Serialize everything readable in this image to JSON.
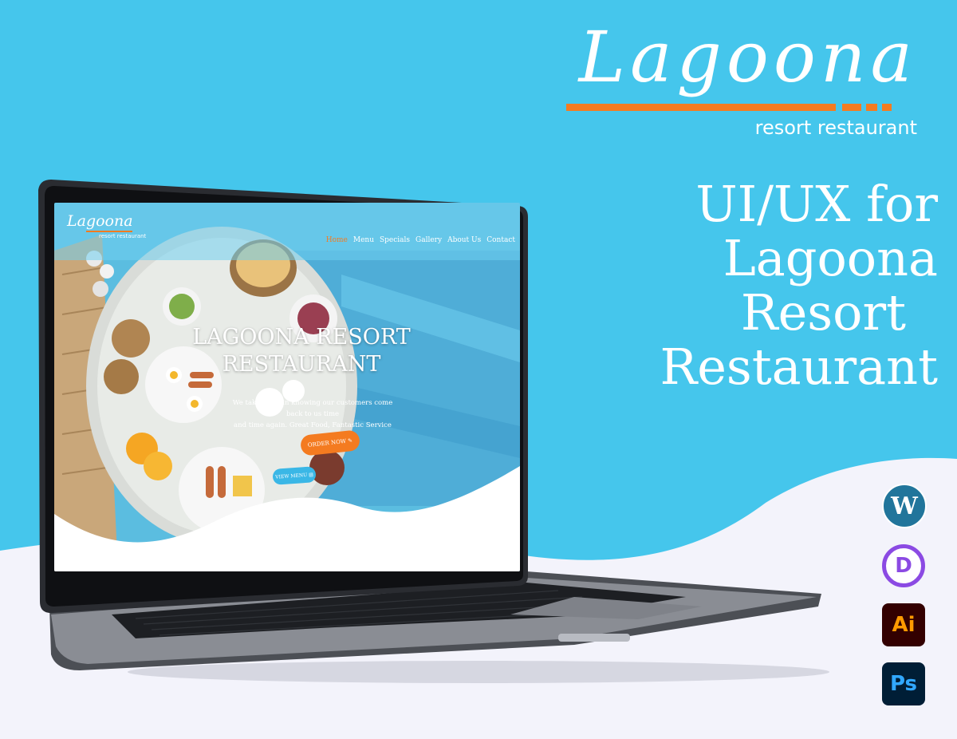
{
  "colors": {
    "background": "#45c6ec",
    "accent": "#f47b20",
    "wave": "#f3f3fb"
  },
  "brand": {
    "logo": "Lagoona",
    "subtitle": "resort restaurant"
  },
  "headline": {
    "line1": "UI/UX for",
    "line2": "Lagoona",
    "line3": "Resort",
    "line4": "Restaurant"
  },
  "tools": [
    {
      "name": "wordpress-icon",
      "label": "W"
    },
    {
      "name": "divi-icon",
      "label": "D"
    },
    {
      "name": "illustrator-icon",
      "label": "Ai"
    },
    {
      "name": "photoshop-icon",
      "label": "Ps"
    }
  ],
  "site": {
    "logo": "Lagoona",
    "logo_sub": "resort restaurant",
    "nav": [
      {
        "label": "Home",
        "active": true
      },
      {
        "label": "Menu",
        "active": false
      },
      {
        "label": "Specials",
        "active": false
      },
      {
        "label": "Gallery",
        "active": false
      },
      {
        "label": "About Us",
        "active": false
      },
      {
        "label": "Contact",
        "active": false
      }
    ],
    "hero_title_line1": "LAGOONA RESORT",
    "hero_title_line2": "RESTAURANT",
    "hero_text_line1": "We take pride in knowing our customers come back to us time",
    "hero_text_line2": "and time again. Great Food, Fantastic Service",
    "order_button": "ORDER NOW ✎",
    "menu_button": "VIEW MENU ▤"
  }
}
